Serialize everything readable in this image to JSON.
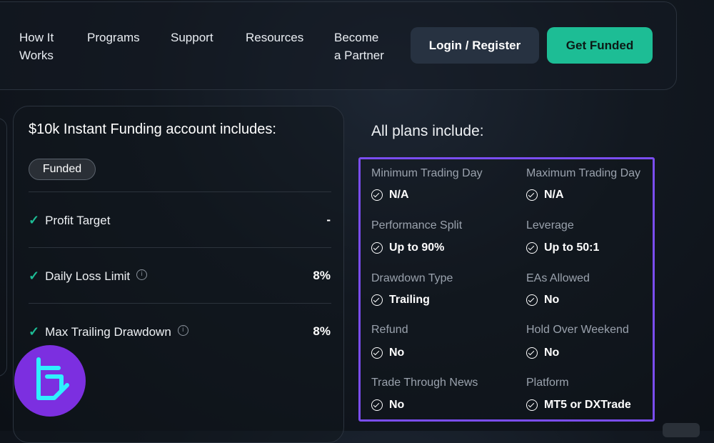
{
  "nav": {
    "items": [
      {
        "line1": "How It",
        "line2": "Works"
      },
      {
        "line1": "Programs",
        "line2": ""
      },
      {
        "line1": "Support",
        "line2": ""
      },
      {
        "line1": "Resources",
        "line2": ""
      },
      {
        "line1": "Become",
        "line2": "a Partner"
      }
    ],
    "login_label": "Login / Register",
    "cta_label": "Get Funded"
  },
  "plan": {
    "title": "$10k Instant Funding account includes:",
    "badge": "Funded",
    "rows": [
      {
        "label": "Profit Target",
        "value": "-",
        "info": false
      },
      {
        "label": "Daily Loss Limit",
        "value": "8%",
        "info": true
      },
      {
        "label": "Max Trailing Drawdown",
        "value": "8%",
        "info": true
      }
    ]
  },
  "includes": {
    "title": "All plans include:",
    "features": [
      {
        "label": "Minimum Trading Day",
        "value": "N/A"
      },
      {
        "label": "Maximum Trading Day",
        "value": "N/A"
      },
      {
        "label": "Performance Split",
        "value": "Up to 90%"
      },
      {
        "label": "Leverage",
        "value": "Up to 50:1"
      },
      {
        "label": "Drawdown Type",
        "value": "Trailing"
      },
      {
        "label": "EAs Allowed",
        "value": "No"
      },
      {
        "label": "Refund",
        "value": "No"
      },
      {
        "label": "Hold Over Weekend",
        "value": "No"
      },
      {
        "label": "Trade Through News",
        "value": "No"
      },
      {
        "label": "Platform",
        "value": "MT5 or DXTrade"
      }
    ]
  },
  "colors": {
    "accent": "#1dbd95",
    "highlight": "#7a4df0",
    "logo_bg": "#7c2fe0",
    "logo_fg": "#2ff0ff"
  }
}
